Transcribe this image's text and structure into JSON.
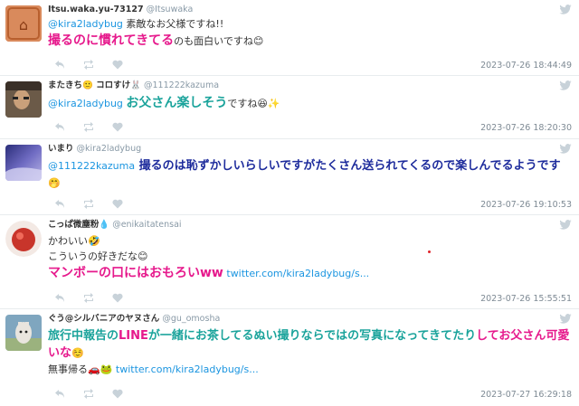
{
  "tweets": [
    {
      "name": "Itsu.waka.yu-73127",
      "handle": "@Itsuwaka",
      "mention": "@kira2ladybug",
      "line1_rest": " 素敵なお父様ですね!!",
      "big": "撮るのに慣れてきてる",
      "big_rest": "のも面白いですね",
      "emoji": "😊",
      "time": "2023-07-26 18:44:49"
    },
    {
      "name": "またきち",
      "name_emoji1": "🙂",
      "name_mid": " コロすけ",
      "name_emoji2": "🐰",
      "handle": "@111222kazuma",
      "mention": "@kira2ladybug",
      "big": "お父さん楽しそう",
      "rest": "ですね",
      "emoji": "😆✨",
      "time": "2023-07-26 18:20:30"
    },
    {
      "name": "いまり",
      "handle": "@kira2ladybug",
      "mention": "@111222kazuma",
      "big": "撮るのは恥ずかしいらしいですがたくさん送られてくるので楽しんでるようです",
      "emoji": "🤭",
      "time": "2023-07-26 19:10:53"
    },
    {
      "name": "こっぱ微塵粉",
      "name_emoji": "💧",
      "handle": "@enikaitatensai",
      "line1": "かわいい",
      "line1_emoji": "🤣",
      "line2": "こういうの好きだな",
      "line2_emoji": "😊",
      "big": "マンボーの口にはおもろいww",
      "link": "twitter.com/kira2ladybug/s...",
      "time": "2023-07-26 15:55:51"
    },
    {
      "name": "ぐう@シルバニアのヤヌさん",
      "handle": "@gu_omosha",
      "big_a": "旅行中報告の",
      "big_b": "LINE",
      "big_c": "が一緒にお茶してるぬい撮りならではの写真になってきてたり",
      "big_d": "してお父さん可愛いな",
      "big_emoji": "☺️",
      "small": "無事帰る",
      "small_emoji": "🚗🐸",
      "link": "twitter.com/kira2ladybug/s...",
      "time": "2023-07-27 16:29:18"
    }
  ],
  "colors": {
    "mention": "#1b95e0",
    "pink": "#e6198c",
    "teal": "#1aa39b",
    "navy": "#1d2b9c",
    "time": "#7e8a94"
  }
}
